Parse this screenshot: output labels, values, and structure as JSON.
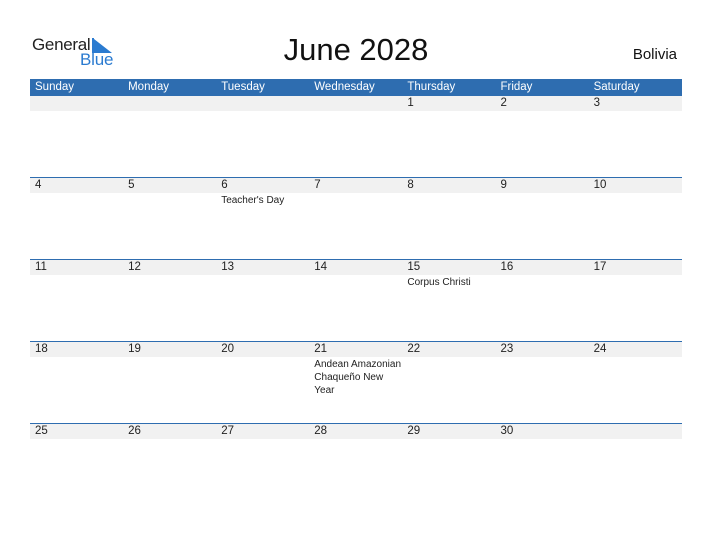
{
  "logo": {
    "word1": "General",
    "word2": "Blue"
  },
  "title": "June 2028",
  "country": "Bolivia",
  "colors": {
    "header_bg": "#2e6db0",
    "day_bar_bg": "#f1f1f1",
    "logo_blue": "#2b7bd0"
  },
  "weekdays": [
    "Sunday",
    "Monday",
    "Tuesday",
    "Wednesday",
    "Thursday",
    "Friday",
    "Saturday"
  ],
  "weeks": [
    {
      "days": [
        "",
        "",
        "",
        "",
        "1",
        "2",
        "3"
      ],
      "events": [
        "",
        "",
        "",
        "",
        "",
        "",
        ""
      ]
    },
    {
      "days": [
        "4",
        "5",
        "6",
        "7",
        "8",
        "9",
        "10"
      ],
      "events": [
        "",
        "",
        "Teacher's Day",
        "",
        "",
        "",
        ""
      ]
    },
    {
      "days": [
        "11",
        "12",
        "13",
        "14",
        "15",
        "16",
        "17"
      ],
      "events": [
        "",
        "",
        "",
        "",
        "Corpus Christi",
        "",
        ""
      ]
    },
    {
      "days": [
        "18",
        "19",
        "20",
        "21",
        "22",
        "23",
        "24"
      ],
      "events": [
        "",
        "",
        "",
        "Andean Amazonian Chaqueño New Year",
        "",
        "",
        ""
      ]
    },
    {
      "days": [
        "25",
        "26",
        "27",
        "28",
        "29",
        "30",
        ""
      ],
      "events": [
        "",
        "",
        "",
        "",
        "",
        "",
        ""
      ]
    }
  ]
}
